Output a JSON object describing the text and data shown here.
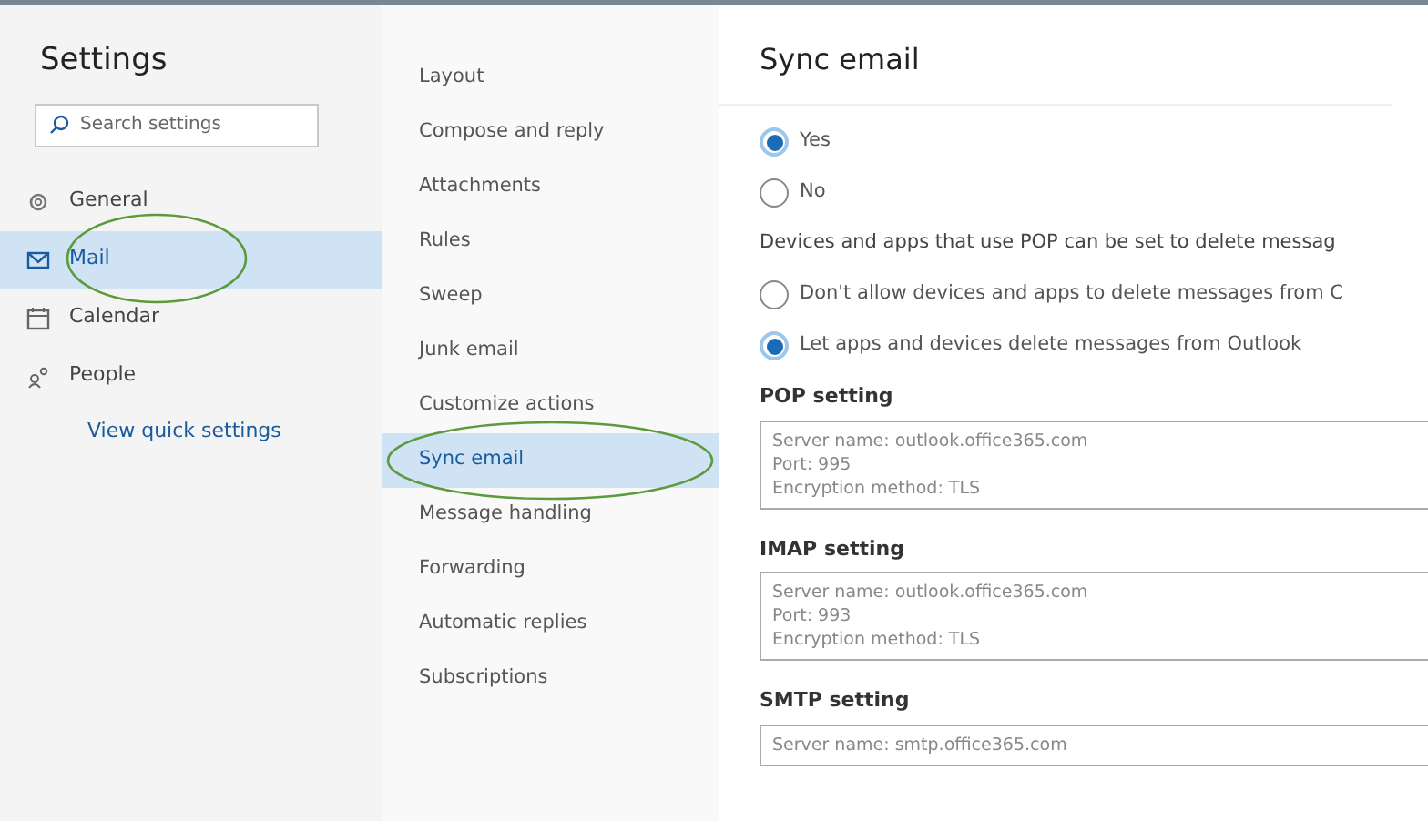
{
  "sidebar": {
    "title": "Settings",
    "search": {
      "placeholder": "Search settings"
    },
    "items": [
      {
        "label": "General",
        "kind": "gear",
        "selected": false,
        "circled": false
      },
      {
        "label": "Mail",
        "kind": "mail",
        "selected": true,
        "circled": true
      },
      {
        "label": "Calendar",
        "kind": "calendar",
        "selected": false,
        "circled": false
      },
      {
        "label": "People",
        "kind": "people",
        "selected": false,
        "circled": false
      }
    ],
    "link": "View quick settings"
  },
  "submenu": {
    "items": [
      {
        "label": "Layout",
        "selected": false,
        "circled": false
      },
      {
        "label": "Compose and reply",
        "selected": false,
        "circled": false
      },
      {
        "label": "Attachments",
        "selected": false,
        "circled": false
      },
      {
        "label": "Rules",
        "selected": false,
        "circled": false
      },
      {
        "label": "Sweep",
        "selected": false,
        "circled": false
      },
      {
        "label": "Junk email",
        "selected": false,
        "circled": false
      },
      {
        "label": "Customize actions",
        "selected": false,
        "circled": false
      },
      {
        "label": "Sync email",
        "selected": true,
        "circled": true
      },
      {
        "label": "Message handling",
        "selected": false,
        "circled": false
      },
      {
        "label": "Forwarding",
        "selected": false,
        "circled": false
      },
      {
        "label": "Automatic replies",
        "selected": false,
        "circled": false
      },
      {
        "label": "Subscriptions",
        "selected": false,
        "circled": false
      }
    ]
  },
  "content": {
    "title": "Sync email",
    "sections": [
      {
        "kind": "radios",
        "options": [
          {
            "label": "Yes",
            "selected": true
          },
          {
            "label": "No",
            "selected": false
          }
        ]
      },
      {
        "kind": "text",
        "text": "Devices and apps that use POP can be set to delete messag"
      },
      {
        "kind": "radios",
        "options": [
          {
            "label": "Don't allow devices and apps to delete messages from C",
            "selected": false
          },
          {
            "label": "Let apps and devices delete messages from Outlook",
            "selected": true
          }
        ]
      },
      {
        "kind": "info",
        "heading": "POP setting",
        "lines": [
          "Server name: outlook.office365.com",
          "Port: 995",
          "Encryption method: TLS"
        ]
      },
      {
        "kind": "info",
        "heading": "IMAP setting",
        "lines": [
          "Server name: outlook.office365.com",
          "Port: 993",
          "Encryption method: TLS"
        ]
      },
      {
        "kind": "info",
        "heading": "SMTP setting",
        "lines": [
          "Server name: smtp.office365.com"
        ]
      }
    ]
  }
}
